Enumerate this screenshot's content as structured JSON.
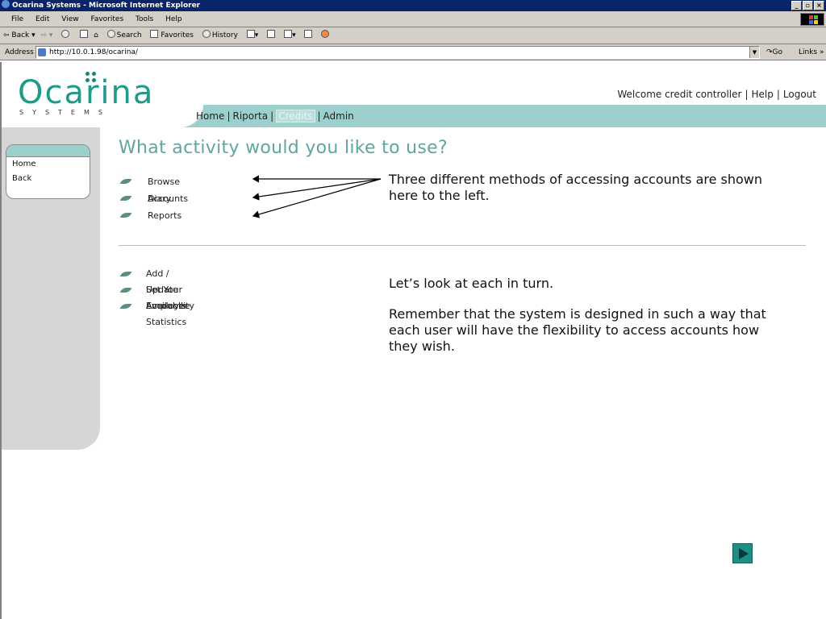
{
  "window": {
    "title": "Ocarina Systems - Microsoft Internet Explorer",
    "buttons": [
      "_",
      "▫",
      "×"
    ]
  },
  "menubar": {
    "items": [
      "File",
      "Edit",
      "View",
      "Favorites",
      "Tools",
      "Help"
    ]
  },
  "toolbar": {
    "back": "Back",
    "search": "Search",
    "favorites": "Favorites",
    "history": "History"
  },
  "addressbar": {
    "label": "Address",
    "url": "http://10.0.1.98/ocarina/",
    "go": "Go",
    "links": "Links"
  },
  "logo": {
    "word": "Ocarina",
    "sub": "SYSTEMS",
    "color": "#1f9a8a"
  },
  "header": {
    "welcome": "Welcome credit controller",
    "help": "Help",
    "logout": "Logout"
  },
  "topnav": {
    "home": "Home",
    "riporta": "Riporta",
    "credits": "Credits",
    "admin": "Admin"
  },
  "sidebar": {
    "items": [
      {
        "label": "Home"
      },
      {
        "label": "Back"
      }
    ]
  },
  "main": {
    "heading": "What activity would you like to use?",
    "primary_items": [
      {
        "label": "Browse Accounts"
      },
      {
        "label": "Diary"
      },
      {
        "label": "Reports"
      }
    ],
    "secondary_items": [
      {
        "label": "Add / Update Accounts"
      },
      {
        "label": "Set Your Availability"
      },
      {
        "label": "Employee Statistics"
      }
    ]
  },
  "callouts": {
    "first": "Three different methods of accessing accounts are shown here to the left.",
    "second": "Let’s look at each in turn.",
    "third": "Remember that the system is designed in such a way that each user will have the flexibility to access accounts how they wish."
  },
  "colors": {
    "accent": "#9dcfcc",
    "heading": "#5fa6a0",
    "next_button": "#1d8f86"
  },
  "icons": {
    "next": "play-arrow-icon",
    "bullet": "leaf-bullet-icon"
  }
}
